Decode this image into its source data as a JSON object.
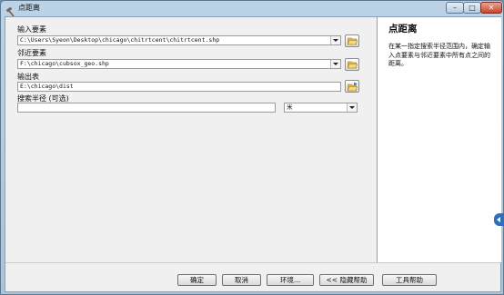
{
  "window": {
    "title": "点距离",
    "title_icon": "hammer-icon",
    "controls": {
      "minimize": "–",
      "maximize": "□",
      "close": "✕"
    }
  },
  "form": {
    "input_features": {
      "label": "输入要素",
      "value": "C:\\Users\\Syeon\\Desktop\\chicago\\chitrtcent\\chitrtcent.shp"
    },
    "near_features": {
      "label": "邻近要素",
      "value": "F:\\chicago\\cubsox_geo.shp"
    },
    "output_table": {
      "label": "输出表",
      "value": "E:\\chicago\\dist"
    },
    "search_radius": {
      "label": "搜索半径 (可选)",
      "value": "",
      "unit": "米"
    }
  },
  "help": {
    "title": "点距离",
    "text": "在某一指定搜索半径范围内，确定输入点要素与邻近要素中所有点之间的距离。"
  },
  "buttons": {
    "ok": "确定",
    "cancel": "取消",
    "environments": "环境...",
    "hide_help": "<< 隐藏帮助",
    "tool_help": "工具帮助"
  }
}
